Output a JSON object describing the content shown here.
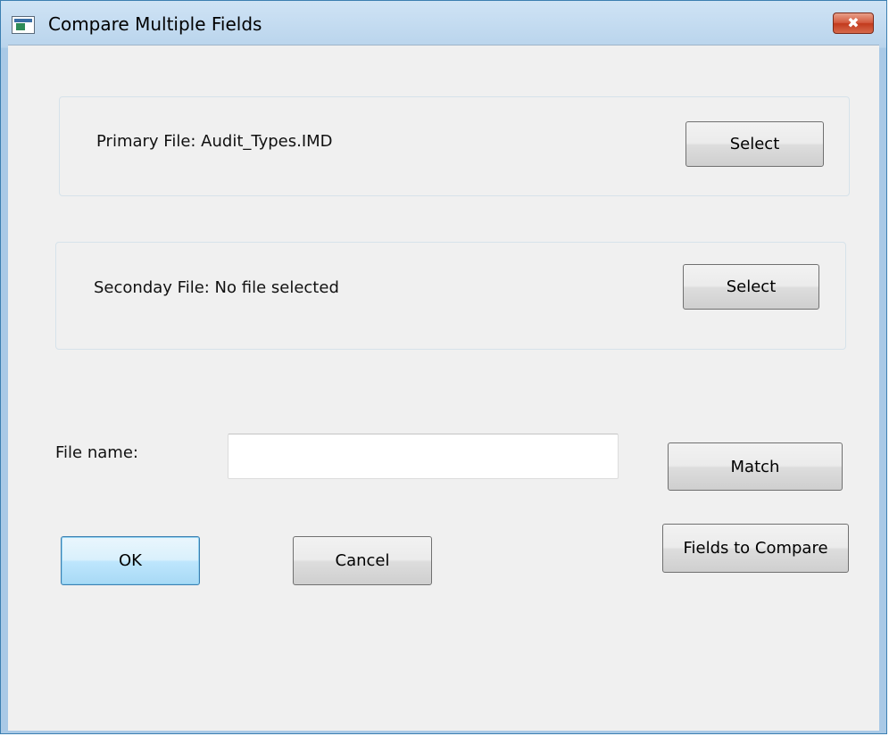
{
  "window": {
    "title": "Compare Multiple Fields",
    "close_glyph": "✖"
  },
  "primary": {
    "label": "Primary File: Audit_Types.IMD",
    "select_label": "Select"
  },
  "secondary": {
    "label": "Seconday File: No file selected",
    "select_label": "Select"
  },
  "output": {
    "file_name_label": "File name:",
    "file_name_value": "",
    "match_label": "Match",
    "fields_to_compare_label": "Fields to Compare"
  },
  "actions": {
    "ok_label": "OK",
    "cancel_label": "Cancel"
  },
  "icons": {
    "title": "app-window-icon",
    "close": "close-icon"
  },
  "colors": {
    "title_bar": "#b9d4ec",
    "close_button": "#c23a1d",
    "client_bg": "#f0f0f0",
    "default_button": "#bee6fd"
  }
}
